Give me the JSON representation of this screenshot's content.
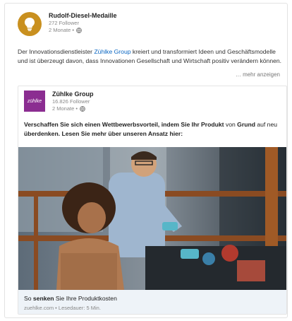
{
  "post": {
    "author": {
      "name": "Rudolf-Diesel-Medaille",
      "followers": "272 Follower",
      "time": "2 Monate •"
    },
    "text_prefix": "Der Innovationsdienstleister ",
    "text_link": "Zühlke Group",
    "text_suffix": " kreiert und transformiert Ideen und Geschäftsmodelle und ist überzeugt davon, dass Innovationen Gesellschaft und Wirtschaft positiv verändern können.",
    "more_label": "… mehr anzeigen"
  },
  "shared": {
    "author": {
      "logo_text": "zühlke",
      "name": "Zühlke Group",
      "followers": "16.826 Follower",
      "time": "2 Monate •"
    },
    "text_part1": "Verschaffen Sie sich einen Wettbewerbsvorteil, indem Sie Ihr Produkt",
    "text_part2": " von ",
    "text_part3": "Grund",
    "text_part4": " auf neu ",
    "text_part5": "überdenken. Lesen Sie mehr über unseren Ansatz hier:",
    "link_title_prefix": "So ",
    "link_title_bold": "senken",
    "link_title_suffix": " Sie Ihre Produktkosten",
    "link_meta": "zuehlke.com • Lesedauer: 5 Min."
  },
  "colors": {
    "accent": "#0a66c2",
    "avatar_outer": "#c9901f",
    "avatar_inner": "#8b2d91"
  }
}
